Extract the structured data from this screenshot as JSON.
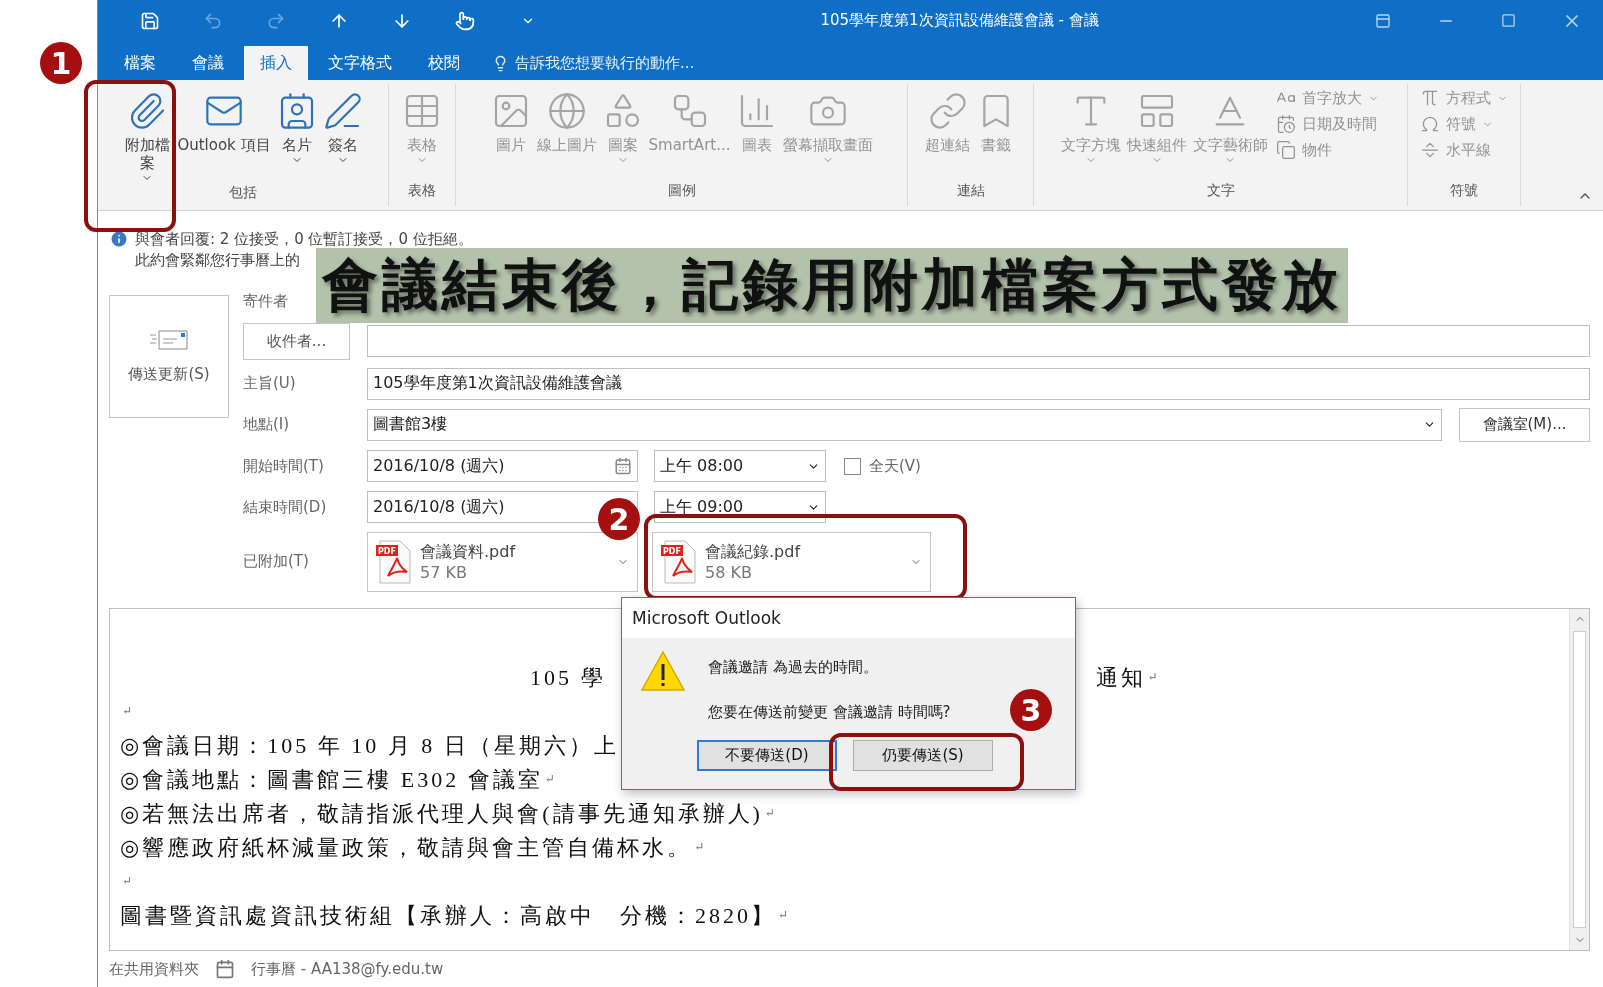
{
  "window": {
    "title": "105學年度第1次資訊設備維護會議 - 會議"
  },
  "tabs": [
    {
      "label": "檔案",
      "selected": false
    },
    {
      "label": "會議",
      "selected": false
    },
    {
      "label": "插入",
      "selected": true
    },
    {
      "label": "文字格式",
      "selected": false
    },
    {
      "label": "校閱",
      "selected": false
    }
  ],
  "tell_me": {
    "placeholder": "告訴我您想要執行的動作..."
  },
  "ribbon": {
    "groups": [
      {
        "label": "包括",
        "items": [
          {
            "kind": "large",
            "label": "附加檔案",
            "disabled": false,
            "dropdown": true
          },
          {
            "kind": "large",
            "label": "Outlook 項目",
            "disabled": false,
            "dropdown": false
          },
          {
            "kind": "large",
            "label": "名片",
            "disabled": false,
            "dropdown": true
          },
          {
            "kind": "large",
            "label": "簽名",
            "disabled": false,
            "dropdown": true
          }
        ]
      },
      {
        "label": "表格",
        "items": [
          {
            "kind": "large",
            "label": "表格",
            "disabled": true,
            "dropdown": true
          }
        ]
      },
      {
        "label": "圖例",
        "items": [
          {
            "kind": "large",
            "label": "圖片",
            "disabled": true,
            "dropdown": false
          },
          {
            "kind": "large",
            "label": "線上圖片",
            "disabled": true,
            "dropdown": false
          },
          {
            "kind": "large",
            "label": "圖案",
            "disabled": true,
            "dropdown": true
          },
          {
            "kind": "large",
            "label": "SmartArt...",
            "disabled": true,
            "dropdown": false
          },
          {
            "kind": "large",
            "label": "圖表",
            "disabled": true,
            "dropdown": false
          },
          {
            "kind": "large",
            "label": "螢幕擷取畫面",
            "disabled": true,
            "dropdown": true
          }
        ]
      },
      {
        "label": "連結",
        "items": [
          {
            "kind": "large",
            "label": "超連結",
            "disabled": true,
            "dropdown": false
          },
          {
            "kind": "large",
            "label": "書籤",
            "disabled": true,
            "dropdown": false
          }
        ]
      },
      {
        "label": "文字",
        "items": [
          {
            "kind": "large",
            "label": "文字方塊",
            "disabled": true,
            "dropdown": true
          },
          {
            "kind": "large",
            "label": "快速組件",
            "disabled": true,
            "dropdown": true
          },
          {
            "kind": "large",
            "label": "文字藝術師",
            "disabled": true,
            "dropdown": true
          },
          {
            "kind": "small",
            "label": "首字放大",
            "disabled": true,
            "dropdown": true
          },
          {
            "kind": "small",
            "label": "日期及時間",
            "disabled": true,
            "dropdown": false
          },
          {
            "kind": "small",
            "label": "物件",
            "disabled": true,
            "dropdown": false
          }
        ]
      },
      {
        "label": "符號",
        "items": [
          {
            "kind": "small",
            "label": "方程式",
            "disabled": true,
            "dropdown": true
          },
          {
            "kind": "small",
            "label": "符號",
            "disabled": true,
            "dropdown": true
          },
          {
            "kind": "small",
            "label": "水平線",
            "disabled": true,
            "dropdown": false
          }
        ]
      }
    ]
  },
  "info_bar": {
    "lines": [
      "與會者回覆: 2 位接受，0 位暫訂接受，0 位拒絕。",
      "此約會緊鄰您行事曆上的"
    ]
  },
  "send_button": {
    "label": "傳送更新(S)"
  },
  "form": {
    "from_label": "寄件者",
    "to_button": "收件者...",
    "subject_label": "主旨(U)",
    "subject": "105學年度第1次資訊設備維護會議",
    "location_label": "地點(I)",
    "location": "圖書館3樓",
    "room_button": "會議室(M)...",
    "start_label": "開始時間(T)",
    "start_date": "2016/10/8 (週六)",
    "start_time": "上午 08:00",
    "all_day": {
      "label": "全天(V)",
      "checked": false
    },
    "end_label": "結束時間(D)",
    "end_date": "2016/10/8 (週六)",
    "end_time": "上午 09:00",
    "attached_label": "已附加(T)",
    "attachments": [
      {
        "badge": "PDF",
        "name": "會議資料.pdf",
        "size": "57 KB"
      },
      {
        "badge": "PDF",
        "name": "會議紀錄.pdf",
        "size": "58 KB"
      }
    ]
  },
  "body": {
    "heading": {
      "parts": [
        "105 學",
        "通知"
      ],
      "mark": "↵"
    },
    "lines": [
      {
        "mark": "↵"
      },
      {
        "text": "◎會議日期：105 年 10 月 8 日（星期六）上"
      },
      {
        "text": "◎會議地點：圖書館三樓 E302 會議室",
        "mark": "↵"
      },
      {
        "text": "◎若無法出席者，敬請指派代理人與會(請事先通知承辦人)",
        "mark": "↵"
      },
      {
        "text": "◎響應政府紙杯減量政策，敬請與會主管自備杯水。",
        "mark": "↵"
      },
      {
        "mark": "↵"
      },
      {
        "text": "圖書暨資訊處資訊技術組【承辦人：高啟中　分機：2820】",
        "mark": "↵"
      }
    ]
  },
  "status_bar": {
    "folder": "在共用資料夾",
    "calendar": "行事曆 - AA138@fy.edu.tw"
  },
  "dialog": {
    "title": "Microsoft Outlook",
    "message": "會議邀請 為過去的時間。",
    "question": "您要在傳送前變更 會議邀請 時間嗎?",
    "buttons": [
      {
        "label": "不要傳送(D)",
        "focused": true
      },
      {
        "label": "仍要傳送(S)",
        "focused": false
      }
    ]
  },
  "annotations": {
    "banner": "會議結束後，記錄用附加檔案方式發放",
    "markers": [
      "1",
      "2",
      "3"
    ]
  }
}
